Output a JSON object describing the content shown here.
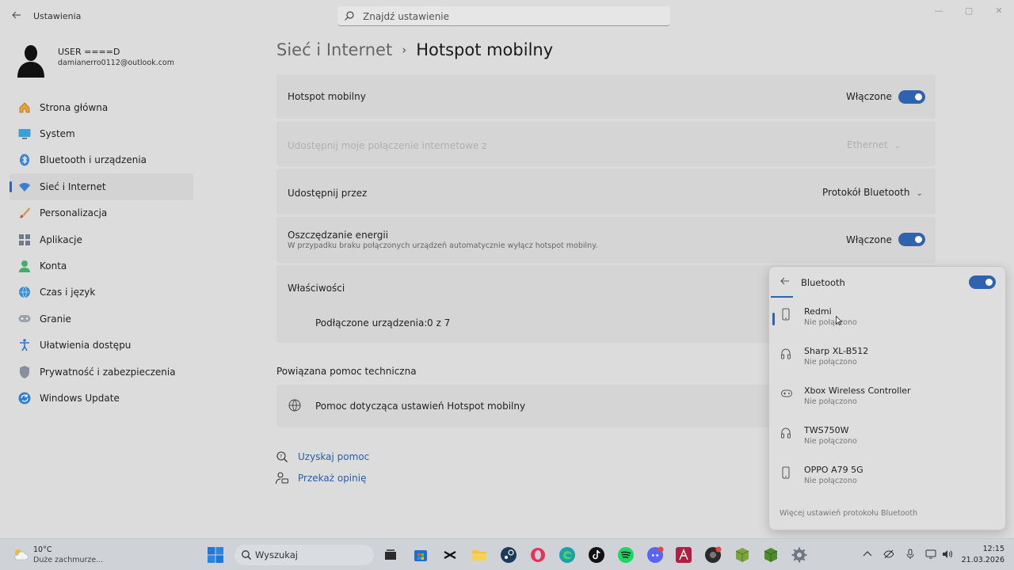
{
  "window": {
    "app_title": "Ustawienia",
    "search_placeholder": "Znajdź ustawienie"
  },
  "profile": {
    "name": "USER ====D",
    "email": "damianerro0112@outlook.com"
  },
  "nav": {
    "items": [
      {
        "label": "Strona główna",
        "icon": "home-icon"
      },
      {
        "label": "System",
        "icon": "monitor-icon"
      },
      {
        "label": "Bluetooth i urządzenia",
        "icon": "bluetooth-icon"
      },
      {
        "label": "Sieć i Internet",
        "icon": "wifi-icon",
        "active": true
      },
      {
        "label": "Personalizacja",
        "icon": "brush-icon"
      },
      {
        "label": "Aplikacje",
        "icon": "apps-icon"
      },
      {
        "label": "Konta",
        "icon": "person-icon"
      },
      {
        "label": "Czas i język",
        "icon": "globe-clock-icon"
      },
      {
        "label": "Granie",
        "icon": "gamepad-icon"
      },
      {
        "label": "Ułatwienia dostępu",
        "icon": "accessibility-icon"
      },
      {
        "label": "Prywatność i zabezpieczenia",
        "icon": "shield-icon"
      },
      {
        "label": "Windows Update",
        "icon": "update-icon"
      }
    ]
  },
  "breadcrumb": {
    "parent": "Sieć i Internet",
    "separator": "›",
    "current": "Hotspot mobilny"
  },
  "settings": {
    "hotspot": {
      "label": "Hotspot mobilny",
      "state": "Włączone"
    },
    "share_from": {
      "label": "Udostępnij moje połączenie internetowe z",
      "value": "Ethernet"
    },
    "share_via": {
      "label": "Udostępnij przez",
      "value": "Protokół Bluetooth"
    },
    "power_saving": {
      "label": "Oszczędzanie energii",
      "description": "W przypadku braku połączonych urządzeń automatycznie wyłącz hotspot mobilny.",
      "state": "Włączone"
    },
    "properties": {
      "label": "Właściwości",
      "connected_label": "Podłączone urządzenia:",
      "connected_value": "0 z 7"
    }
  },
  "help": {
    "section_title": "Powiązana pomoc techniczna",
    "item": "Pomoc dotycząca ustawień Hotspot mobilny",
    "get_help": "Uzyskaj pomoc",
    "feedback": "Przekaż opinię"
  },
  "bluetooth_flyout": {
    "title": "Bluetooth",
    "devices": [
      {
        "name": "Redmi",
        "status": "Nie połączono",
        "icon": "phone-icon"
      },
      {
        "name": "Sharp XL-B512",
        "status": "Nie połączono",
        "icon": "headset-icon"
      },
      {
        "name": "Xbox Wireless Controller",
        "status": "Nie połączono",
        "icon": "gamepad-icon"
      },
      {
        "name": "TWS750W",
        "status": "Nie połączono",
        "icon": "headset-icon"
      },
      {
        "name": "OPPO A79 5G",
        "status": "Nie połączono",
        "icon": "phone-icon"
      }
    ],
    "more_settings": "Więcej ustawień protokołu Bluetooth"
  },
  "taskbar": {
    "weather_temp": "10°C",
    "weather_desc": "Duże zachmurze...",
    "search_label": "Wyszukaj",
    "time": "12:15",
    "date": "21.03.2026"
  },
  "colors": {
    "accent": "#2f63b0",
    "link": "#2a5ca8"
  }
}
